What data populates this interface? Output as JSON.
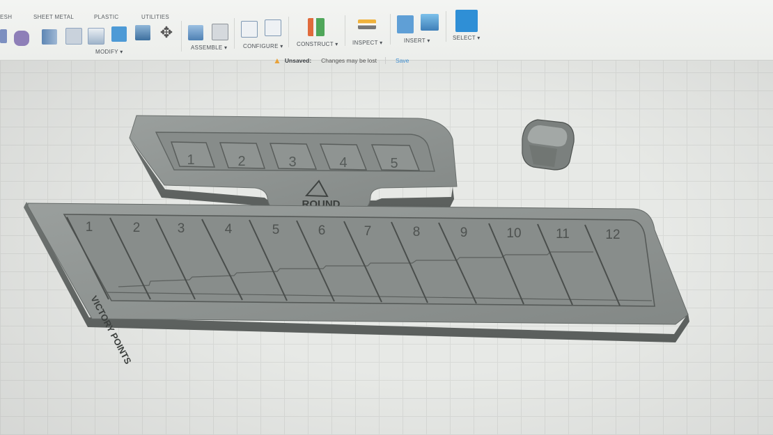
{
  "toolbar": {
    "tabs": [
      "ESH",
      "SHEET METAL",
      "PLASTIC",
      "UTILITIES"
    ],
    "groups": {
      "modify": "MODIFY ▾",
      "assemble": "ASSEMBLE ▾",
      "configure": "CONFIGURE ▾",
      "construct": "CONSTRUCT ▾",
      "inspect": "INSPECT ▾",
      "insert": "INSERT ▾",
      "select": "SELECT ▾"
    }
  },
  "status": {
    "unsaved_title": "Unsaved:",
    "unsaved_message": "Changes may be lost",
    "save_label": "Save"
  },
  "model": {
    "round_tracker": {
      "numbers": [
        "1",
        "2",
        "3",
        "4",
        "5"
      ],
      "label": "ROUND"
    },
    "vp_board": {
      "side_label": "VICTORY POINTS",
      "numbers": [
        "1",
        "2",
        "3",
        "4",
        "5",
        "6",
        "7",
        "8",
        "9",
        "10",
        "11",
        "12"
      ]
    }
  },
  "colors": {
    "model_face": "#8c9190",
    "model_side": "#6d7271",
    "model_dark": "#545857",
    "accent_blue": "#3f8fd0",
    "warning": "#e8a23a"
  }
}
